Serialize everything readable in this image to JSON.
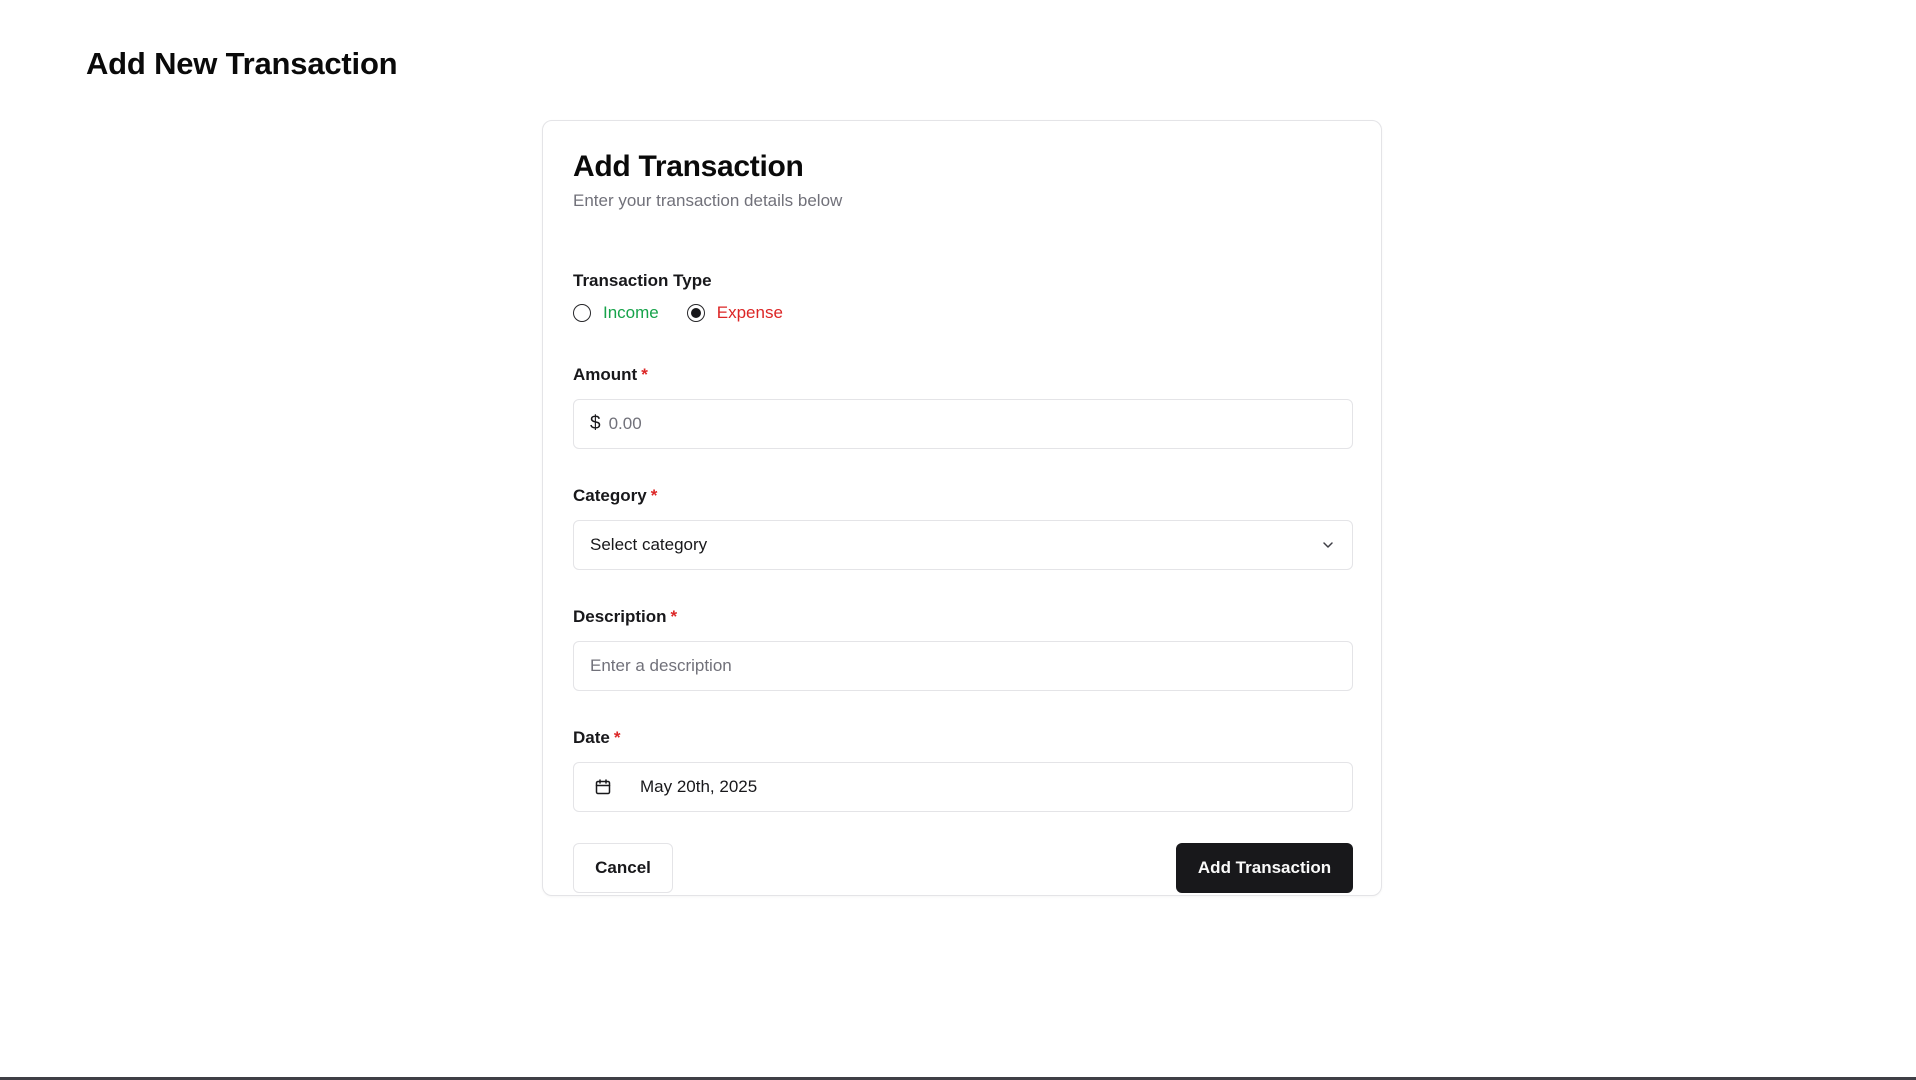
{
  "page": {
    "title": "Add New Transaction"
  },
  "card": {
    "title": "Add Transaction",
    "subtitle": "Enter your transaction details below"
  },
  "transaction_type": {
    "label": "Transaction Type",
    "options": [
      {
        "label": "Income",
        "color": "#16a34a",
        "selected": false
      },
      {
        "label": "Expense",
        "color": "#dc2626",
        "selected": true
      }
    ]
  },
  "amount": {
    "label": "Amount",
    "required_mark": "*",
    "currency_symbol": "$",
    "placeholder": "0.00",
    "value": ""
  },
  "category": {
    "label": "Category",
    "required_mark": "*",
    "selected_value": "Select category",
    "icon": "chevron-down-icon"
  },
  "description": {
    "label": "Description",
    "required_mark": "*",
    "placeholder": "Enter a description",
    "value": ""
  },
  "date": {
    "label": "Date",
    "required_mark": "*",
    "value": "May 20th, 2025",
    "icon": "calendar-icon"
  },
  "actions": {
    "cancel_label": "Cancel",
    "submit_label": "Add Transaction"
  },
  "colors": {
    "primary": "#18181b",
    "border": "#e4e4e7",
    "muted_text": "#71717a",
    "required": "#dc2626",
    "income": "#16a34a",
    "expense": "#dc2626"
  }
}
